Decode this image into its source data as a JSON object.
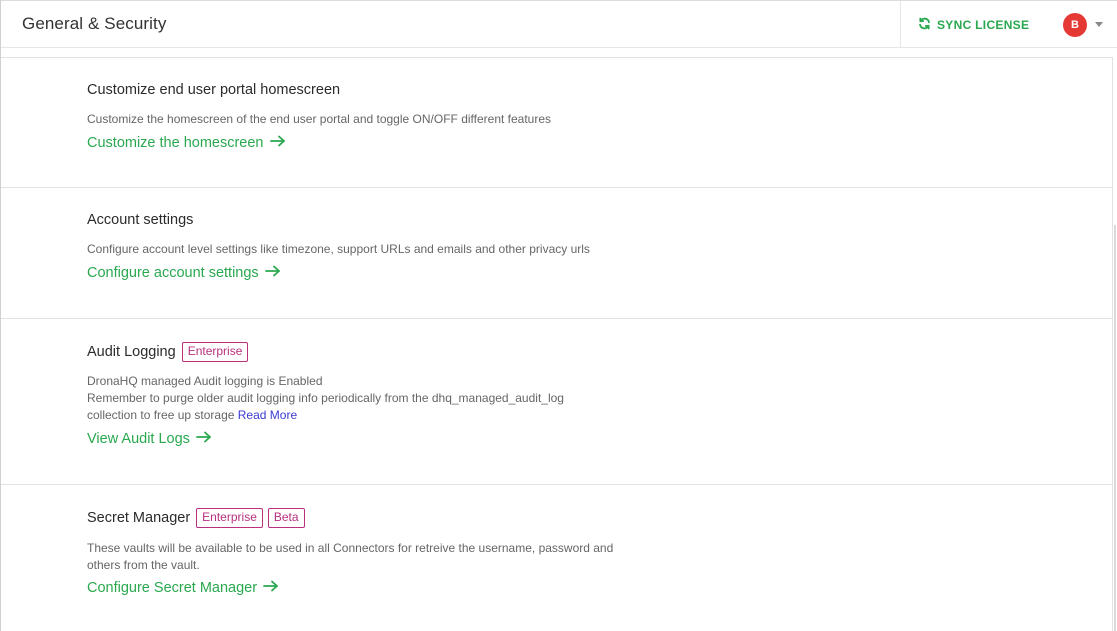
{
  "header": {
    "title": "General & Security",
    "sync_label": "SYNC LICENSE",
    "avatar_initial": "B"
  },
  "sections": [
    {
      "title": "Customize end user portal homescreen",
      "description": "Customize the homescreen of the end user portal and toggle ON/OFF different features",
      "link_label": "Customize the homescreen"
    },
    {
      "title": "Account settings",
      "description": "Configure account level settings like timezone, support URLs and emails and other privacy urls",
      "link_label": "Configure account settings"
    },
    {
      "title": "Audit Logging",
      "badges": [
        "Enterprise"
      ],
      "description_lines": [
        "DronaHQ managed Audit logging is Enabled",
        "Remember to purge older audit logging info periodically from the dhq_managed_audit_log",
        "collection to free up storage"
      ],
      "read_more": "Read More",
      "link_label": "View Audit Logs"
    },
    {
      "title": "Secret Manager",
      "badges": [
        "Enterprise",
        "Beta"
      ],
      "description_lines": [
        "These vaults will be available to be used in all Connectors for retreive the username, password and",
        "others from the vault."
      ],
      "link_label": "Configure Secret Manager"
    }
  ],
  "colors": {
    "accent_green": "#2aa84f",
    "badge_magenta": "#b8307e",
    "avatar_red": "#e53935",
    "read_more_blue": "#3b3bd1"
  },
  "icons": [
    "sync-icon",
    "arrow-right-icon",
    "chevron-down-icon"
  ]
}
